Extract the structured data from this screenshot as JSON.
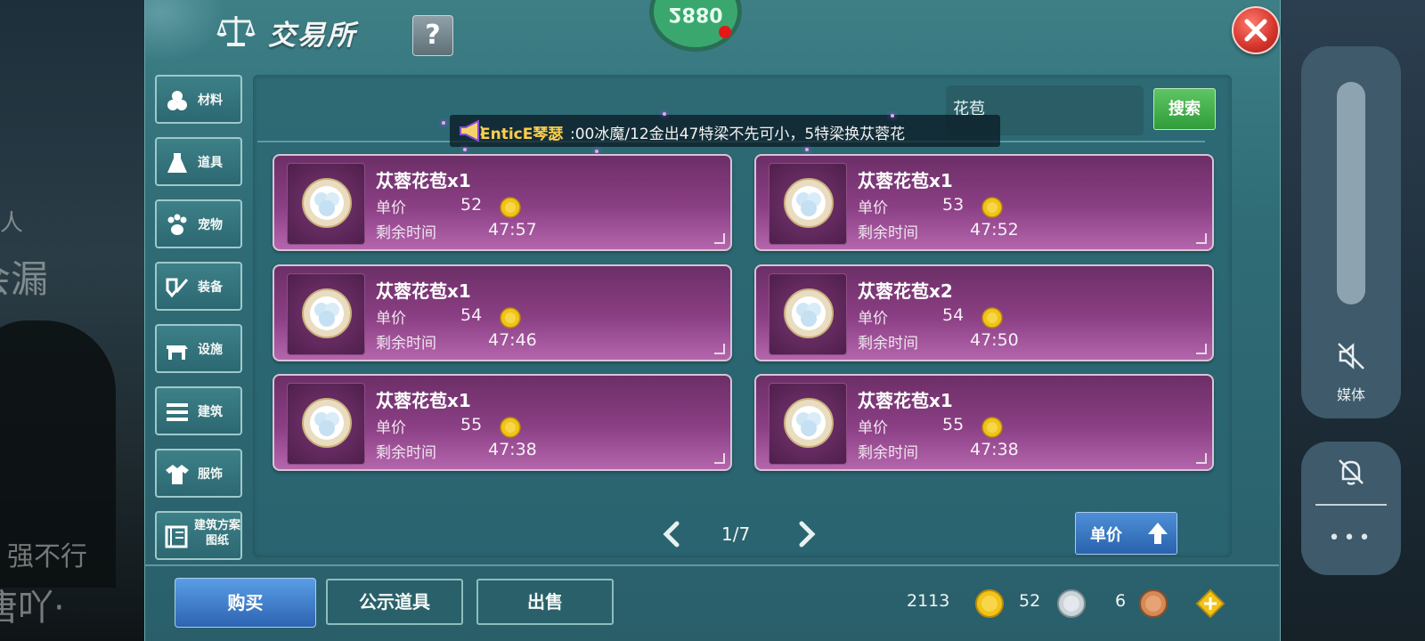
{
  "background": {
    "left_texts": [
      "人",
      "会漏",
      "强不行",
      "唐吖·"
    ]
  },
  "window": {
    "title": "交易所",
    "help_label": "?",
    "avatar_text": "2880"
  },
  "sidebar": {
    "items": [
      {
        "label": "材料",
        "icon": "materials-icon"
      },
      {
        "label": "道具",
        "icon": "props-icon"
      },
      {
        "label": "宠物",
        "icon": "pet-paw-icon"
      },
      {
        "label": "装备",
        "icon": "equipment-icon"
      },
      {
        "label": "设施",
        "icon": "facility-icon"
      },
      {
        "label": "建筑",
        "icon": "building-icon"
      },
      {
        "label": "服饰",
        "icon": "clothing-icon"
      },
      {
        "label": "建筑方案图纸",
        "icon": "blueprint-icon"
      }
    ]
  },
  "search": {
    "value": "花苞",
    "button_label": "搜索"
  },
  "ticker": {
    "sender": "EnticE琴瑟",
    "message": ":00冰魔/12金出47特梁不先可小，5特梁换苁蓉花"
  },
  "listings": [
    {
      "name": "苁蓉花苞x1",
      "price_label": "单价",
      "price": "52",
      "time_label": "剩余时间",
      "time": "47:57"
    },
    {
      "name": "苁蓉花苞x1",
      "price_label": "单价",
      "price": "53",
      "time_label": "剩余时间",
      "time": "47:52"
    },
    {
      "name": "苁蓉花苞x1",
      "price_label": "单价",
      "price": "54",
      "time_label": "剩余时间",
      "time": "47:46"
    },
    {
      "name": "苁蓉花苞x2",
      "price_label": "单价",
      "price": "54",
      "time_label": "剩余时间",
      "time": "47:50"
    },
    {
      "name": "苁蓉花苞x1",
      "price_label": "单价",
      "price": "55",
      "time_label": "剩余时间",
      "time": "47:38"
    },
    {
      "name": "苁蓉花苞x1",
      "price_label": "单价",
      "price": "55",
      "time_label": "剩余时间",
      "time": "47:38"
    }
  ],
  "pagination": {
    "text": "1/7"
  },
  "sort_button": {
    "label": "单价"
  },
  "bottom": {
    "buy_label": "购买",
    "public_label": "公示道具",
    "sell_label": "出售"
  },
  "currency": {
    "gold": "2113",
    "silver": "52",
    "bronze": "6"
  },
  "system": {
    "media_label": "媒体",
    "more_label": "•••"
  },
  "colors": {
    "panel": "#2f6c76",
    "card": "#8b3f84",
    "buy": "#2d64b2",
    "search": "#2f9c3a",
    "close": "#d3342b"
  }
}
